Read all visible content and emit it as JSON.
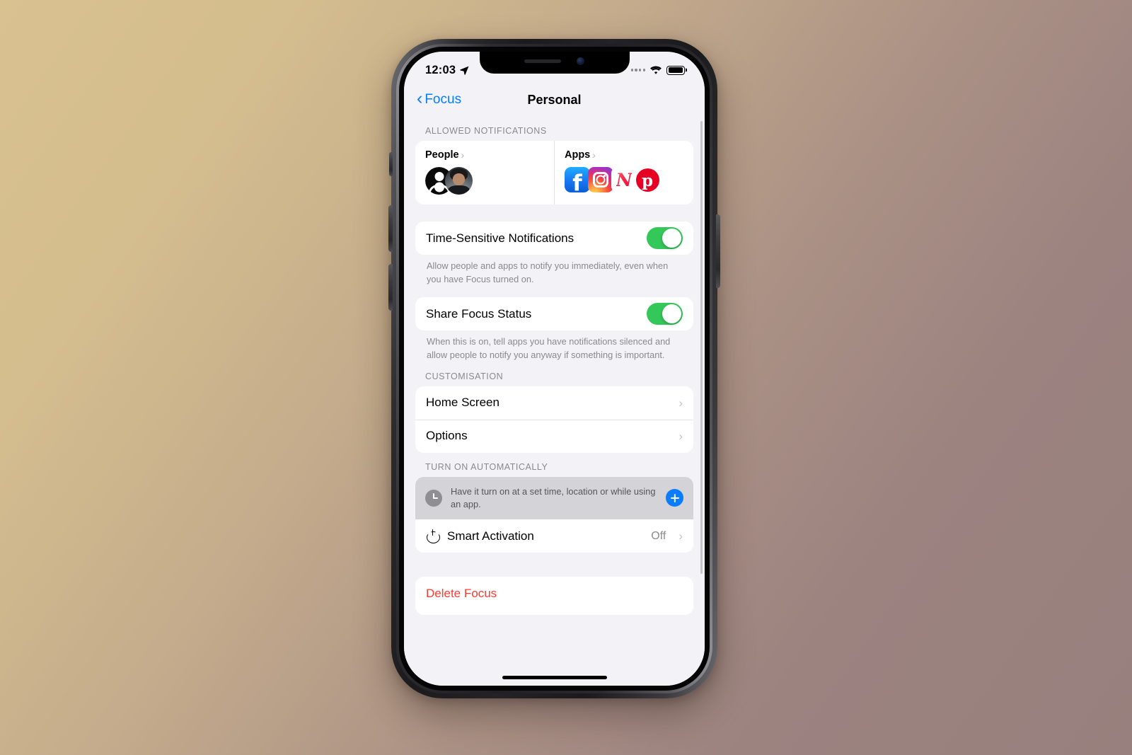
{
  "status_bar": {
    "time": "12:03",
    "location_icon": "location-arrow-icon",
    "cellular_icon": "cellular-dots-icon",
    "wifi_icon": "wifi-icon",
    "battery_icon": "battery-icon"
  },
  "nav": {
    "back_label": "Focus",
    "back_icon": "chevron-left-icon",
    "title": "Personal"
  },
  "allowed_notifications": {
    "header": "ALLOWED NOTIFICATIONS",
    "people": {
      "title": "People",
      "chevron": "›",
      "avatars": [
        "generic-person-avatar",
        "photo-avatar"
      ]
    },
    "apps": {
      "title": "Apps",
      "chevron": "›",
      "icons": [
        {
          "name": "facebook-app-icon",
          "glyph": "f"
        },
        {
          "name": "instagram-app-icon",
          "glyph": ""
        },
        {
          "name": "apple-news-app-icon",
          "glyph": "N"
        },
        {
          "name": "pinterest-app-icon",
          "glyph": "p"
        }
      ]
    }
  },
  "time_sensitive": {
    "label": "Time-Sensitive Notifications",
    "toggle_on": true,
    "footnote": "Allow people and apps to notify you immediately, even when you have Focus turned on."
  },
  "share_focus_status": {
    "label": "Share Focus Status",
    "toggle_on": true,
    "footnote": "When this is on, tell apps you have notifications silenced and allow people to notify you anyway if something is important."
  },
  "customisation": {
    "header": "CUSTOMISATION",
    "rows": [
      {
        "label": "Home Screen",
        "chevron": "›"
      },
      {
        "label": "Options",
        "chevron": "›"
      }
    ]
  },
  "turn_on_automatically": {
    "header": "TURN ON AUTOMATICALLY",
    "prompt": {
      "icon": "clock-icon",
      "text": "Have it turn on at a set time, location or while using an app.",
      "add_button": "add-schedule-button"
    },
    "smart_activation": {
      "icon": "power-icon",
      "label": "Smart Activation",
      "value": "Off",
      "chevron": "›"
    }
  },
  "delete": {
    "label": "Delete Focus"
  },
  "colors": {
    "accent_blue": "#0a7cff",
    "toggle_green": "#34c759",
    "destructive_red": "#ff3b30",
    "group_bg": "#f2f2f7",
    "card_bg": "#ffffff",
    "secondary_text": "#8a8a8e"
  }
}
